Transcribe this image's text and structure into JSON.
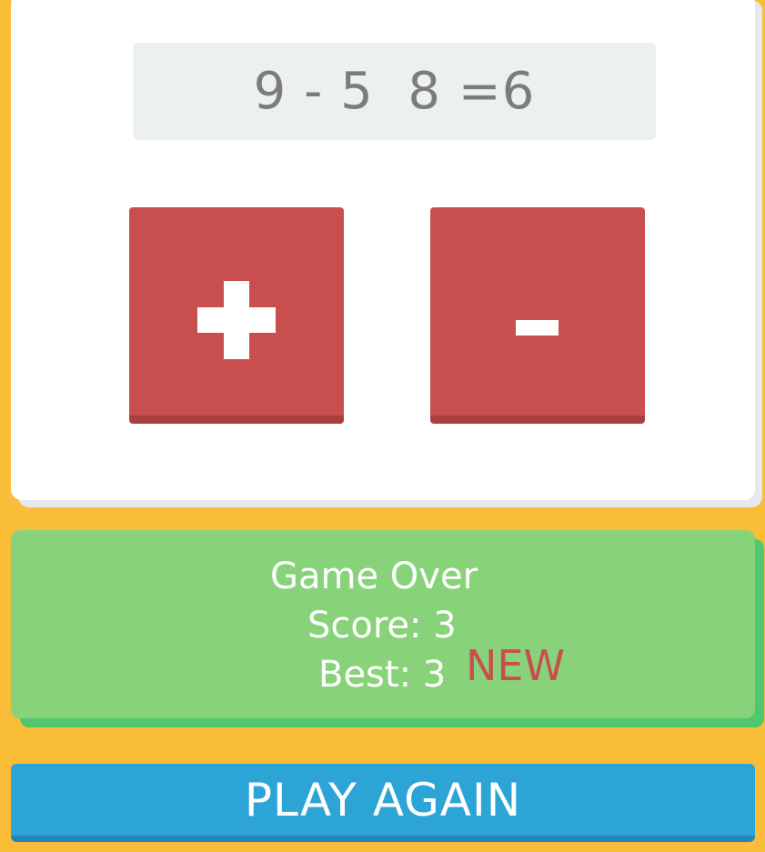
{
  "equation": {
    "text": "9 - 5  8 =6"
  },
  "buttons": {
    "plus_icon": "plus-icon",
    "minus_icon": "minus-icon"
  },
  "result": {
    "title": "Game Over",
    "score_label": "Score: 3",
    "best_label": "Best: 3",
    "new_badge": "NEW"
  },
  "play_again": {
    "label": "PLAY AGAIN"
  },
  "colors": {
    "background": "#f9bd38",
    "operator_button": "#c94f4e",
    "result_panel": "#88d37a",
    "play_again_button": "#2ca4d6",
    "new_badge": "#c94f4e"
  }
}
